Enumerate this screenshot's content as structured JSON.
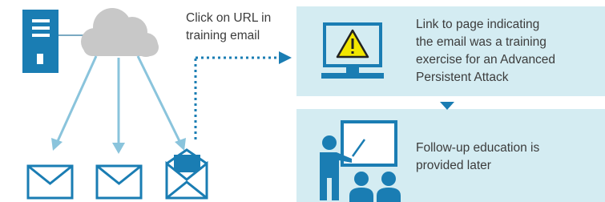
{
  "step1": {
    "line1": "Click on URL in",
    "line2": "training email"
  },
  "box1": {
    "lines": [
      "Link to page indicating",
      "the email was a training",
      "exercise for an Advanced",
      "Persistent Attack"
    ]
  },
  "box2": {
    "lines": [
      "Follow-up education is",
      "provided later"
    ]
  },
  "colors": {
    "primary": "#1a7db3",
    "light_arrow": "#8ac4dc",
    "box_bg": "#d4ecf2",
    "cloud": "#c8c8c8",
    "warning": "#f2e600"
  },
  "icons": [
    "server-icon",
    "cloud-icon",
    "envelope-icon",
    "open-envelope-icon",
    "computer-warning-icon",
    "teacher-board-icon",
    "students-icon"
  ]
}
